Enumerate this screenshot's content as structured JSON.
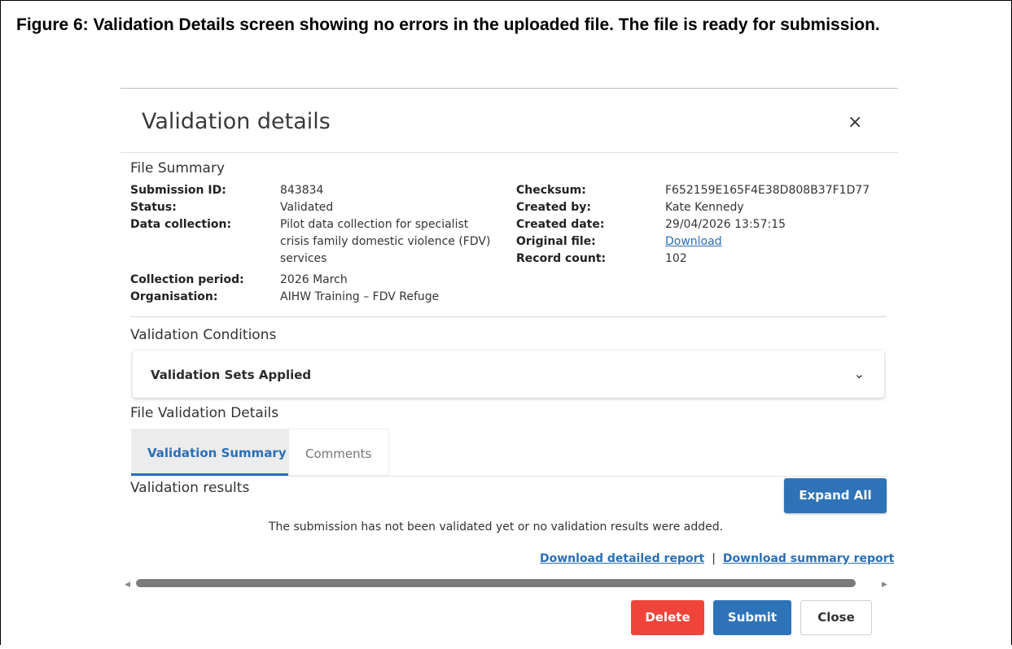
{
  "caption": "Figure 6: Validation Details screen showing no errors in the uploaded file. The file is ready for submission.",
  "dialog": {
    "title": "Validation details",
    "close_icon": "×"
  },
  "file_summary": {
    "heading": "File Summary",
    "left": [
      {
        "label": "Submission ID:",
        "value": "843834"
      },
      {
        "label": "Status:",
        "value": "Validated"
      },
      {
        "label": "Data collection:",
        "value": "Pilot data collection for specialist crisis family domestic violence (FDV) services"
      },
      {
        "label": "Collection period:",
        "value": "2026 March"
      },
      {
        "label": "Organisation:",
        "value": "AIHW Training – FDV Refuge"
      }
    ],
    "right": [
      {
        "label": "Checksum:",
        "value": "F652159E165F4E38D808B37F1D77"
      },
      {
        "label": "Created by:",
        "value": "Kate Kennedy"
      },
      {
        "label": "Created date:",
        "value": "29/04/2026 13:57:15"
      },
      {
        "label": "Original file:",
        "value": "Download"
      },
      {
        "label": "Record count:",
        "value": "102"
      }
    ]
  },
  "validation_conditions": {
    "heading": "Validation Conditions",
    "accordion_label": "Validation Sets Applied",
    "chevron": "⌄"
  },
  "file_validation": {
    "heading": "File Validation Details",
    "tabs": [
      {
        "label": "Validation Summary",
        "active": true
      },
      {
        "label": "Comments",
        "active": false
      }
    ],
    "results_heading": "Validation results",
    "expand_all_label": "Expand All",
    "message": "The submission has not been validated yet or no validation results were added.",
    "download_detailed": "Download detailed report",
    "separator": "|",
    "download_summary": "Download summary report"
  },
  "scrollbar": {
    "left_arrow": "◀",
    "right_arrow": "▶"
  },
  "footer": {
    "delete_label": "Delete",
    "submit_label": "Submit",
    "close_label": "Close"
  },
  "colors": {
    "primary": "#2e73b8",
    "danger": "#f0443a",
    "link": "#2a6fb5"
  }
}
